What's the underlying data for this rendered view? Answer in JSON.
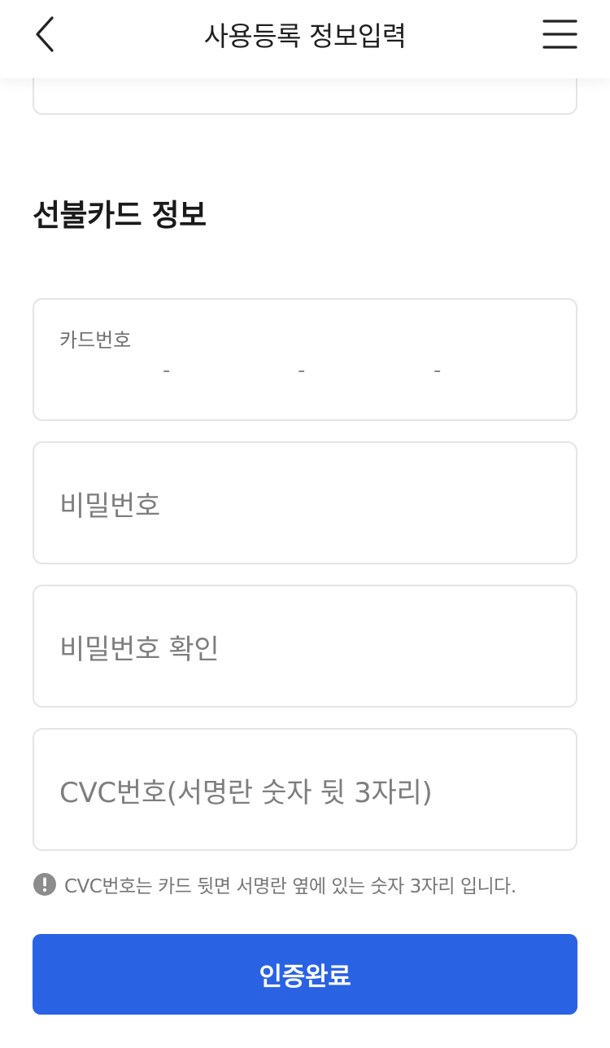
{
  "header": {
    "title": "사용등록 정보입력",
    "back_icon": "chevron-left-icon",
    "menu_icon": "hamburger-menu-icon"
  },
  "section": {
    "title": "선불카드 정보"
  },
  "card_number": {
    "label": "카드번호",
    "separator": "-"
  },
  "password": {
    "placeholder": "비밀번호"
  },
  "password_confirm": {
    "placeholder": "비밀번호 확인"
  },
  "cvc": {
    "placeholder": "CVC번호(서명란 숫자 뒷 3자리)"
  },
  "notice": {
    "icon": "exclamation-circle-icon",
    "text": "CVC번호는 카드 뒷면 서명란 옆에 있는 숫자 3자리 입니다."
  },
  "submit": {
    "label": "인증완료"
  },
  "colors": {
    "primary": "#2a62e4",
    "border": "#e4e4e4",
    "placeholder": "#7e7e7e"
  }
}
